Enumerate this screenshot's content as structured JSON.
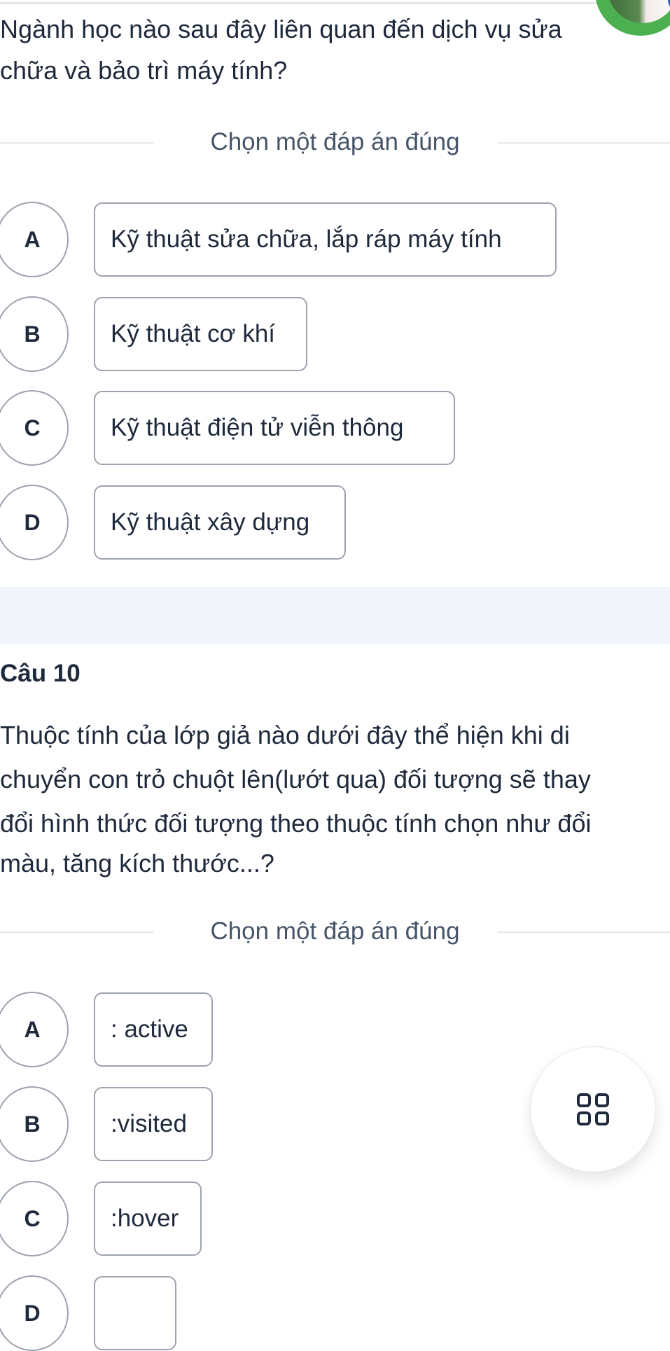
{
  "header": {
    "avatar": "user-avatar"
  },
  "question9": {
    "text_line1": "Ngành học nào sau đây liên quan đến dịch vụ sửa",
    "text_line2": "chữa và bảo trì máy tính?",
    "instruction": "Chọn một đáp án đúng",
    "options": [
      {
        "letter": "A",
        "label": "Kỹ thuật sửa chữa, lắp ráp máy tính"
      },
      {
        "letter": "B",
        "label": "Kỹ thuật cơ khí"
      },
      {
        "letter": "C",
        "label": "Kỹ thuật điện tử viễn thông"
      },
      {
        "letter": "D",
        "label": "Kỹ thuật xây dựng"
      }
    ]
  },
  "question10": {
    "number": "Câu 10",
    "lines": [
      "Thuộc tính của lớp giả nào dưới đây thể hiện khi di",
      "chuyển con trỏ chuột lên(lướt qua) đối tượng sẽ thay",
      "đổi hình thức đối tượng theo thuộc tính chọn như đổi",
      "màu, tăng kích thước...?"
    ],
    "instruction": "Chọn một đáp án đúng",
    "options": [
      {
        "letter": "A",
        "label": ": active"
      },
      {
        "letter": "B",
        "label": ":visited"
      },
      {
        "letter": "C",
        "label": ":hover"
      },
      {
        "letter": "D",
        "label": ""
      }
    ]
  },
  "fab": {
    "icon": "grid-icon"
  },
  "colors": {
    "text": "#1e293b",
    "border": "#9ca3af",
    "band": "#f1f5f9",
    "avatar_ring": "#4caf50"
  }
}
